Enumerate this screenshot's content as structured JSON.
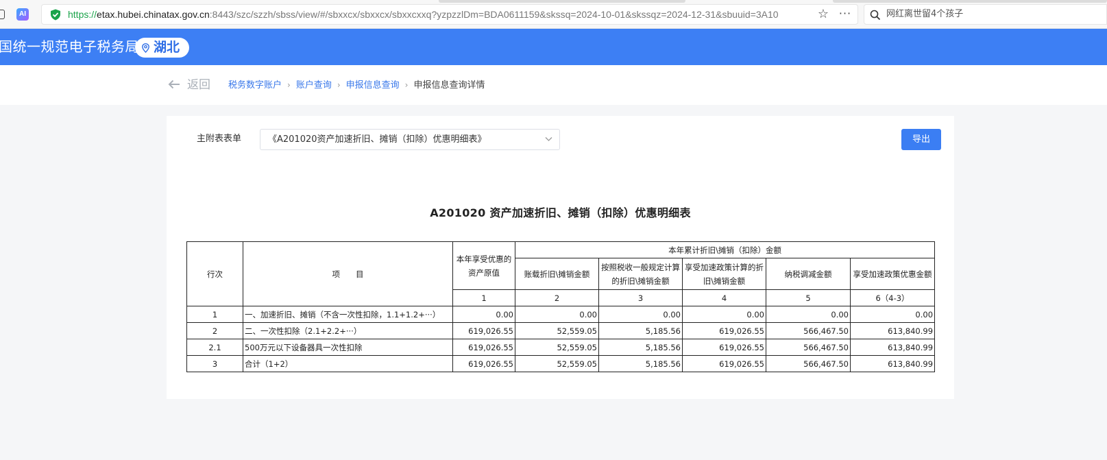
{
  "browser": {
    "address": {
      "scheme": "https://",
      "host": "etax.hubei.chinatax.gov.cn",
      "path": ":8443/szc/szzh/sbss/view/#/sbxxcx/sbxxcx/sbxxcxxq?yzpzzlDm=BDA0611159&skssq=2024-10-01&skssqz=2024-12-31&sbuuid=3A10"
    },
    "search_text": "网红离世留4个孩子"
  },
  "header": {
    "site_title": "国统一规范电子税务局",
    "region": "湖北"
  },
  "breadcrumb": {
    "back_label": "返回",
    "items": [
      "税务数字账户",
      "账户查询",
      "申报信息查询"
    ],
    "current": "申报信息查询详情"
  },
  "form": {
    "label": "主附表表单",
    "selected": "《A201020资产加速折旧、摊销（扣除）优惠明细表》",
    "export_label": "导出"
  },
  "table": {
    "title": "A201020 资产加速折旧、摊销（扣除）优惠明细表",
    "headers": {
      "row_no": "行次",
      "item": "项　　目",
      "original_value": "本年享受优惠的资产原值",
      "group": "本年累计折旧\\摊销（扣除）金额",
      "book_depr": "账载折旧\\摊销金额",
      "general_depr": "按照税收一般规定计算的折旧\\摊销金额",
      "accel_depr": "享受加速政策计算的折旧\\摊销金额",
      "tax_adjust": "纳税调减金额",
      "accel_benefit": "享受加速政策优惠金额"
    },
    "col_numbers": [
      "1",
      "2",
      "3",
      "4",
      "5",
      "6（4-3）"
    ],
    "rows": [
      {
        "no": "1",
        "item": "一、加速折旧、摊销（不含一次性扣除，1.1+1.2+···）",
        "v1": "0.00",
        "v2": "0.00",
        "v3": "0.00",
        "v4": "0.00",
        "v5": "0.00",
        "v6": "0.00"
      },
      {
        "no": "2",
        "item": "二、一次性扣除（2.1+2.2+···）",
        "v1": "619,026.55",
        "v2": "52,559.05",
        "v3": "5,185.56",
        "v4": "619,026.55",
        "v5": "566,467.50",
        "v6": "613,840.99"
      },
      {
        "no": "2.1",
        "item": "500万元以下设备器具一次性扣除",
        "v1": "619,026.55",
        "v2": "52,559.05",
        "v3": "5,185.56",
        "v4": "619,026.55",
        "v5": "566,467.50",
        "v6": "613,840.99"
      },
      {
        "no": "3",
        "item": "合计（1+2）",
        "v1": "619,026.55",
        "v2": "52,559.05",
        "v3": "5,185.56",
        "v4": "619,026.55",
        "v5": "566,467.50",
        "v6": "613,840.99"
      }
    ]
  },
  "colors": {
    "header_blue": "#3d7ff4",
    "link_blue": "#3a78ea",
    "https_green": "#1aa34a"
  }
}
